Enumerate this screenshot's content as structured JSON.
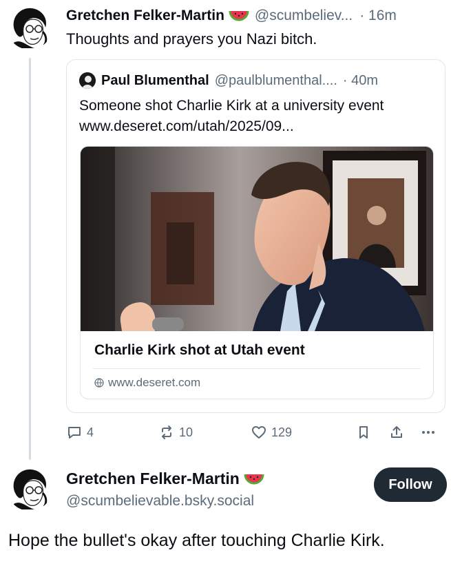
{
  "post1": {
    "author_name": "Gretchen Felker-Martin",
    "author_emoji": "watermelon-icon",
    "handle": "@scumbeliev...",
    "time": "· 16m",
    "text": "Thoughts and prayers you Nazi bitch."
  },
  "quote": {
    "author_name": "Paul Blumenthal",
    "handle": "@paulblumenthal....",
    "time": "· 40m",
    "text": "Someone shot Charlie Kirk at a university event www.deseret.com/utah/2025/09...",
    "link_card": {
      "title": "Charlie Kirk shot at Utah event",
      "domain": "www.deseret.com"
    }
  },
  "actions": {
    "replies": "4",
    "reposts": "10",
    "likes": "129"
  },
  "post2": {
    "author_name": "Gretchen Felker-Martin",
    "author_emoji": "watermelon-icon",
    "handle": "@scumbelievable.bsky.social",
    "follow_label": "Follow",
    "text": "Hope the bullet's okay after touching Charlie Kirk."
  },
  "colors": {
    "text": "#0b0f14",
    "muted": "#5b6b7a",
    "border": "#dfe4e9",
    "follow_button": "#1f2a35"
  }
}
